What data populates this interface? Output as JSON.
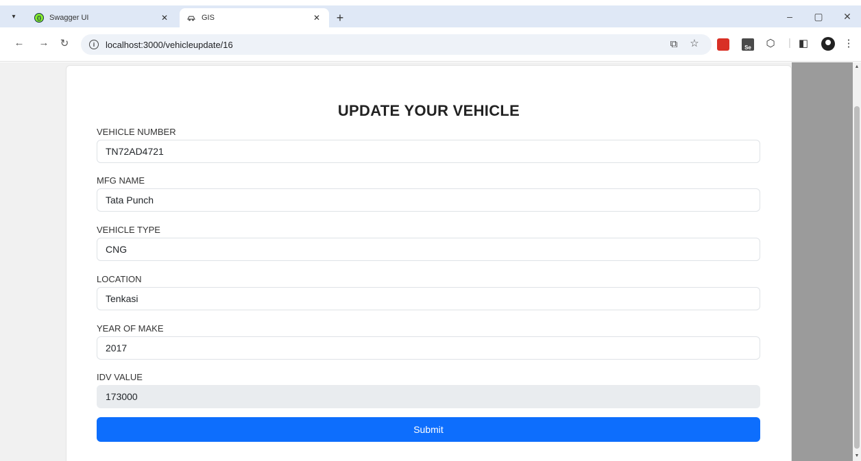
{
  "browser": {
    "tabs": [
      {
        "title": "Swagger UI",
        "active": false
      },
      {
        "title": "GIS",
        "active": true
      }
    ],
    "url": "localhost:3000/vehicleupdate/16",
    "icons": {
      "tab_menu": "chevron-down-icon",
      "back": "back-arrow-icon",
      "forward": "forward-arrow-icon",
      "reload": "reload-icon",
      "site_info": "info-icon",
      "install": "install-app-icon",
      "bookmark": "star-icon",
      "extensions": "puzzle-icon",
      "side_panel": "side-panel-icon",
      "profile": "profile-icon",
      "menu": "kebab-menu-icon"
    }
  },
  "form": {
    "title": "UPDATE YOUR VEHICLE",
    "fields": [
      {
        "label": "VEHICLE NUMBER",
        "value": "TN72AD4721",
        "disabled": false
      },
      {
        "label": "MFG NAME",
        "value": "Tata Punch",
        "disabled": false
      },
      {
        "label": "VEHICLE TYPE",
        "value": "CNG",
        "disabled": false
      },
      {
        "label": "LOCATION",
        "value": "Tenkasi",
        "disabled": false
      },
      {
        "label": "YEAR OF MAKE",
        "value": "2017",
        "disabled": false
      },
      {
        "label": "IDV VALUE",
        "value": "173000",
        "disabled": true
      }
    ],
    "submit_label": "Submit"
  },
  "colors": {
    "primary": "#0d6efd",
    "disabled_bg": "#e9ecef",
    "tabstrip": "#dfe8f6"
  }
}
